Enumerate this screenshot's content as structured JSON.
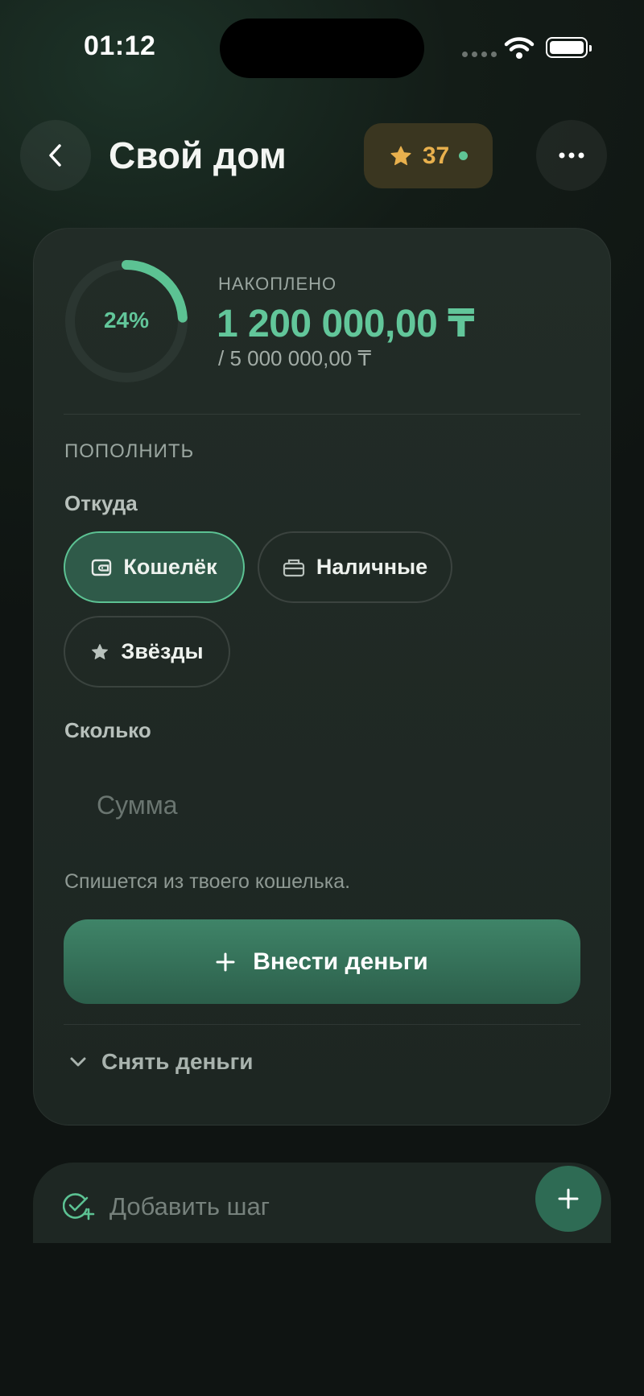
{
  "status_bar": {
    "time": "01:12"
  },
  "header": {
    "title": "Свой дом",
    "stars_count": "37",
    "back_icon": "chevron-left-icon",
    "more_icon": "more-horizontal-icon"
  },
  "progress": {
    "percent_label": "24%",
    "fraction": 0.24,
    "caption": "НАКОПЛЕНО",
    "saved": "1 200 000,00 ₸",
    "goal": "/ 5 000 000,00 ₸"
  },
  "topup": {
    "caption": "ПОПОЛНИТЬ",
    "from_label": "Откуда",
    "sources": [
      {
        "label": "Кошелёк",
        "icon": "wallet-icon",
        "selected": true
      },
      {
        "label": "Наличные",
        "icon": "cash-icon",
        "selected": false
      },
      {
        "label": "Звёзды",
        "icon": "star-icon",
        "selected": false
      }
    ],
    "amount_label": "Сколько",
    "amount_placeholder": "Сумма",
    "amount_value": "",
    "hint": "Спишется из твоего кошелька.",
    "deposit_button": "Внести деньги",
    "withdraw_label": "Снять деньги"
  },
  "steps": {
    "placeholder": "Добавить шаг"
  },
  "colors": {
    "accent": "#62c69a",
    "stars": "#e8b04d",
    "button": "#2f6d55",
    "card": "#202a25"
  }
}
